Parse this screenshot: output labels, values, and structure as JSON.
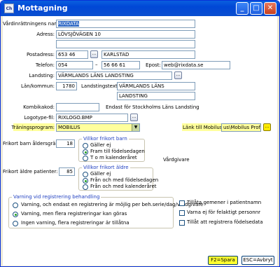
{
  "window": {
    "title": "Mottagning",
    "app_icon": "Ch",
    "buttons": {
      "minimize": "_",
      "maximize": "□",
      "close": "✕"
    }
  },
  "form": {
    "vardinrattning": {
      "label": "Vårdinrättningens namn:",
      "value": "RIXDATA"
    },
    "adress": {
      "label": "Adress:",
      "line1": "LÖVSJÖVÄGEN 10",
      "line2": ""
    },
    "postadress": {
      "label": "Postadress:",
      "postnr": "653 46",
      "ort": "KARLSTAD"
    },
    "telefon": {
      "label": "Telefon:",
      "prefix": "054",
      "dash": "–",
      "number": "56 66 61"
    },
    "epost": {
      "label": "Epost:",
      "value": "web@rixdata.se"
    },
    "landsting": {
      "label": "Landsting:",
      "value": "VÄRMLANDS LÄNS LANDSTING"
    },
    "lan_kommun": {
      "label": "Län/kommun:",
      "value": "1780"
    },
    "landstingstext": {
      "label": "Landstingstext:",
      "line1": "VÄRMLANDS LÄNS",
      "line2": "LANDSTING"
    },
    "kombikod": {
      "label": "Kombikakod:",
      "value": "",
      "note": "Endast för Stockholms Läns Landsting"
    },
    "logotype": {
      "label": "Logotype-fil:",
      "value": "RIXLOGO.BMP"
    },
    "traningsprogram": {
      "label": "Träningsprogram:",
      "value": "MOBILUS"
    },
    "lank_mobilus": {
      "label": "Länk till Mobilus:",
      "value": "us\\Mobilus Professional"
    }
  },
  "frikort_barn": {
    "label": "Frikort barn åldersgräns:",
    "value": "18",
    "group_title": "Villkor frikort barn",
    "options": [
      "Gäller ej",
      "Fram till födelsedagen",
      "T o m kalenderåret"
    ],
    "selected": 1
  },
  "vardgivare_label": "Vårdgivare",
  "frikort_aldre": {
    "label": "Frikort äldre patienter:",
    "value": "85",
    "group_title": "Villkor frikort äldre",
    "options": [
      "Gäller ej",
      "Från och med födelsedagen",
      "Från och med kalenderåret"
    ],
    "selected": 1
  },
  "varning": {
    "group_title": "Varning vid registrering behandling",
    "options": [
      "Varning, och endast en registrering är möjlig per beh.serie/dag/vårdgivare",
      "Varning, men flera registreringar kan göras",
      "Ingen varning, flera registreringar är tillåtna"
    ],
    "selected": 1
  },
  "checkboxes": [
    {
      "label": "Tillåta gemener i patientnamn",
      "checked": false
    },
    {
      "label": "Varna ej för felaktigt personnr",
      "checked": false
    },
    {
      "label": "Tillåt att registrera födelsedata",
      "checked": false
    }
  ],
  "footer": {
    "save": "F2=Spara",
    "cancel": "ESC=Avbryt"
  },
  "icons": {
    "ellipsis": "...",
    "dropdown": "chevron-down-icon"
  }
}
